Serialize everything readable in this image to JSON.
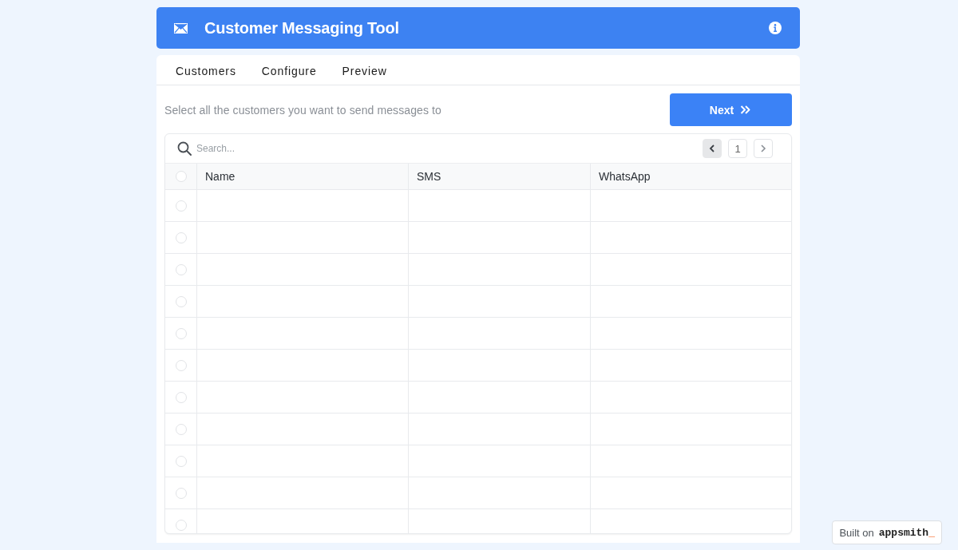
{
  "header": {
    "title": "Customer Messaging Tool"
  },
  "tabs": [
    {
      "label": "Customers"
    },
    {
      "label": "Configure"
    },
    {
      "label": "Preview"
    }
  ],
  "instructions": "Select all the customers you want to send messages to",
  "next_button": {
    "label": "Next"
  },
  "table": {
    "search": {
      "placeholder": "Search..."
    },
    "pagination": {
      "page": "1"
    },
    "select_all": {
      "checked": false
    },
    "columns": [
      {
        "label": "Name"
      },
      {
        "label": "SMS"
      },
      {
        "label": "WhatsApp"
      }
    ],
    "rows": [
      {
        "selected": false
      },
      {
        "selected": false
      },
      {
        "selected": false
      },
      {
        "selected": false
      },
      {
        "selected": false
      },
      {
        "selected": false
      },
      {
        "selected": false
      },
      {
        "selected": false
      },
      {
        "selected": false
      },
      {
        "selected": false
      },
      {
        "selected": false
      }
    ]
  },
  "badge": {
    "prefix": "Built on",
    "brand": "appsmith",
    "suffix": "_"
  }
}
